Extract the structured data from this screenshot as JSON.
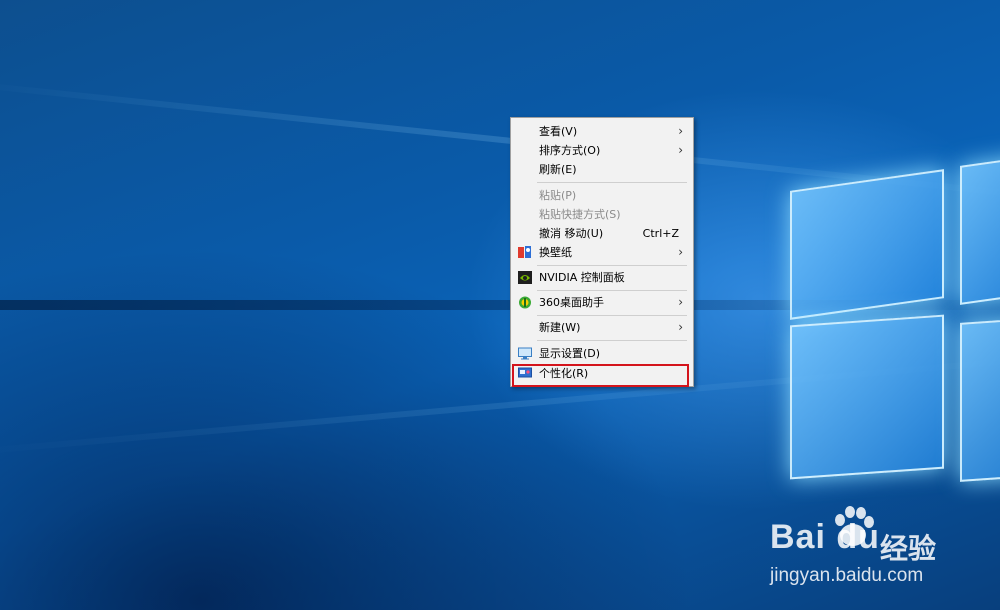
{
  "context_menu": {
    "items": [
      {
        "label": "查看(V)",
        "submenu": true,
        "icon": null
      },
      {
        "label": "排序方式(O)",
        "submenu": true,
        "icon": null
      },
      {
        "label": "刷新(E)",
        "submenu": false,
        "icon": null
      },
      {
        "label": "粘贴(P)",
        "disabled": true
      },
      {
        "label": "粘贴快捷方式(S)",
        "disabled": true
      },
      {
        "label": "撤消 移动(U)",
        "shortcut": "Ctrl+Z"
      },
      {
        "label": "换壁纸",
        "submenu": true,
        "icon": "wallpaper-icon"
      },
      {
        "label": "NVIDIA 控制面板",
        "icon": "nvidia-icon"
      },
      {
        "label": "360桌面助手",
        "submenu": true,
        "icon": "360-icon"
      },
      {
        "label": "新建(W)",
        "submenu": true
      },
      {
        "label": "显示设置(D)",
        "icon": "display-icon"
      },
      {
        "label": "个性化(R)",
        "icon": "personalize-icon",
        "highlighted": true
      }
    ]
  },
  "colors": {
    "highlight_box": "#d4141c",
    "menu_bg": "#f2f2f2",
    "desktop_blue": "#0a5aa8"
  },
  "watermark": {
    "logo_text": "Bai du",
    "jingyan": "经验",
    "url": "jingyan.baidu.com"
  }
}
